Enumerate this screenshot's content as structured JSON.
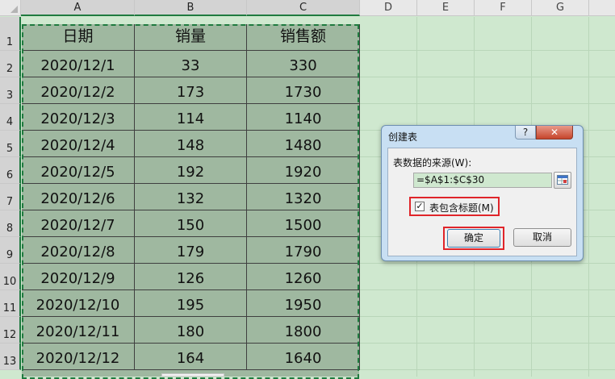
{
  "columns": [
    "A",
    "B",
    "C",
    "D",
    "E",
    "F",
    "G"
  ],
  "rows": [
    "1",
    "2",
    "3",
    "4",
    "5",
    "6",
    "7",
    "8",
    "9",
    "10",
    "11",
    "12",
    "13"
  ],
  "table": {
    "headers": [
      "日期",
      "销量",
      "销售额"
    ],
    "data": [
      [
        "2020/12/1",
        "33",
        "330"
      ],
      [
        "2020/12/2",
        "173",
        "1730"
      ],
      [
        "2020/12/3",
        "114",
        "1140"
      ],
      [
        "2020/12/4",
        "148",
        "1480"
      ],
      [
        "2020/12/5",
        "192",
        "1920"
      ],
      [
        "2020/12/6",
        "132",
        "1320"
      ],
      [
        "2020/12/7",
        "150",
        "1500"
      ],
      [
        "2020/12/8",
        "179",
        "1790"
      ],
      [
        "2020/12/9",
        "126",
        "1260"
      ],
      [
        "2020/12/10",
        "195",
        "1950"
      ],
      [
        "2020/12/11",
        "180",
        "1800"
      ],
      [
        "2020/12/12",
        "164",
        "1640"
      ]
    ]
  },
  "dialog": {
    "title": "创建表",
    "help_label": "?",
    "close_label": "✕",
    "source_label": "表数据的来源(W):",
    "source_value": "=$A$1:$C$30",
    "has_headers_label": "表包含标题(M)",
    "has_headers_checked": true,
    "check_mark": "✓",
    "ok_label": "确定",
    "cancel_label": "取消"
  },
  "colors": {
    "selection_fill": "#9fb8a0",
    "sheet_bg": "#cfe8cf",
    "highlight_border": "#e0252a",
    "marquee": "#1f7a3f"
  }
}
